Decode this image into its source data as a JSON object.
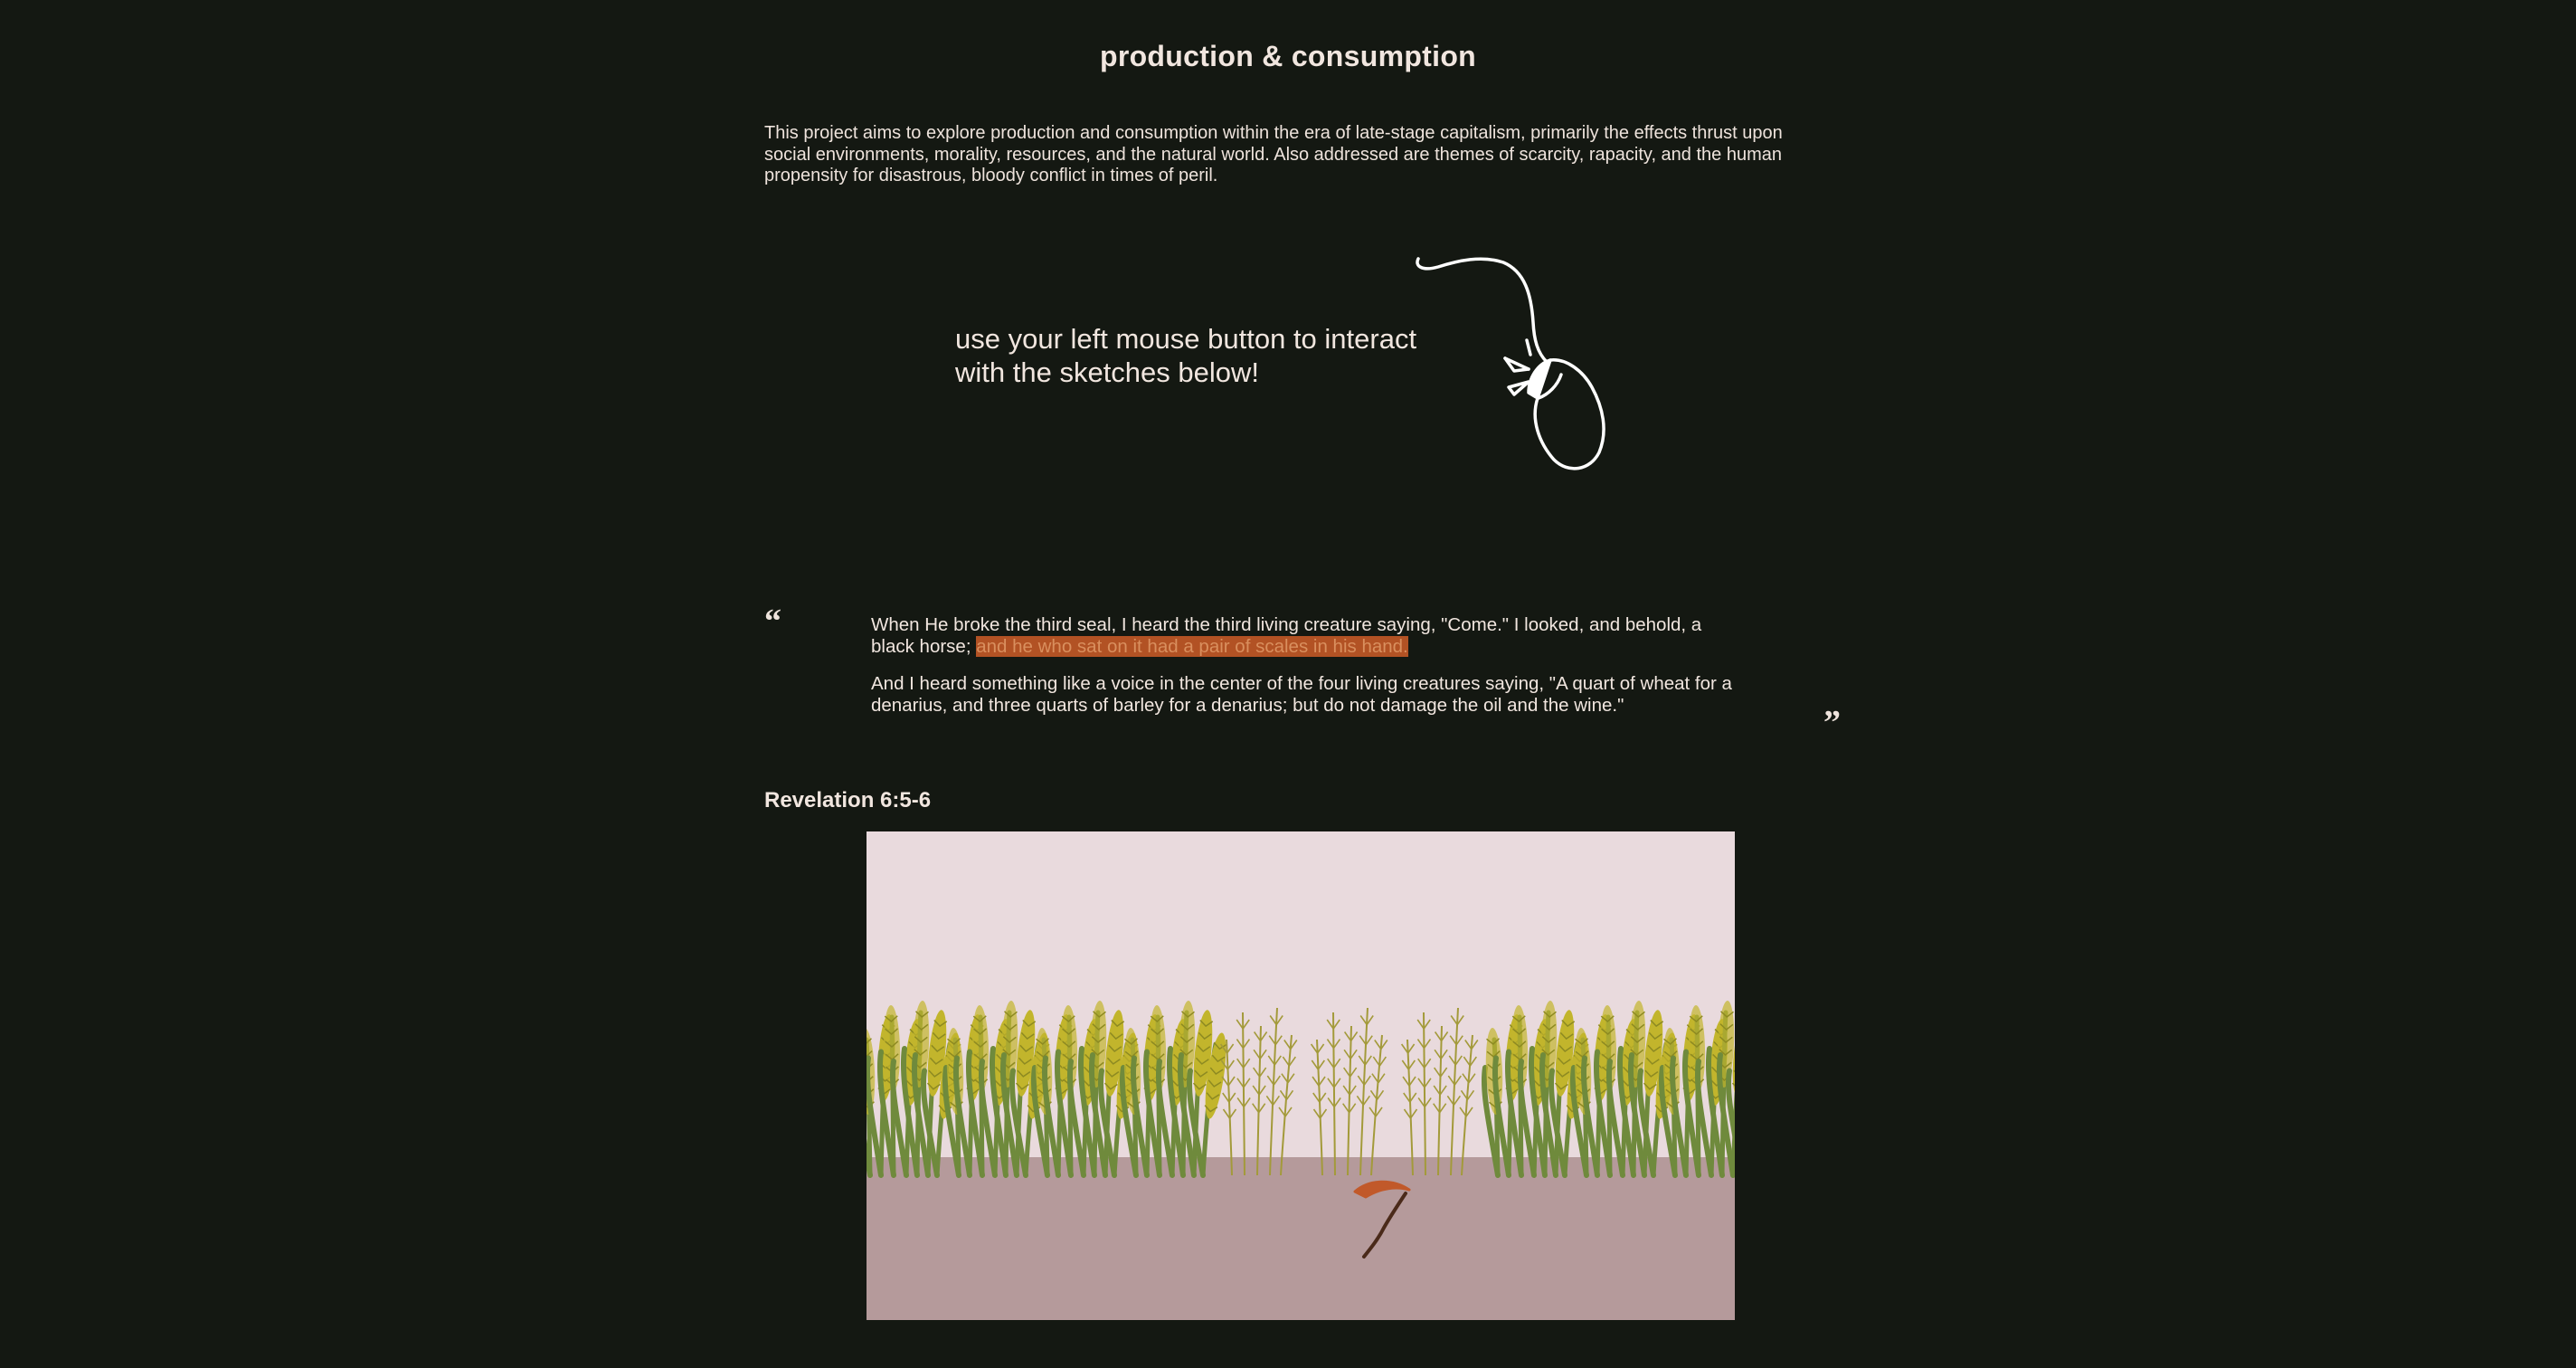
{
  "header": {
    "title": "production & consumption"
  },
  "intro": {
    "text": "This project aims to explore production and consumption within the era of late-stage capitalism, primarily the effects thrust upon social environments, morality, resources, and the natural world. Also addressed are themes of scarcity, rapacity, and the human propensity for disastrous, bloody conflict in times of peril."
  },
  "instruction": {
    "text": "use your left mouse button to interact with the sketches below!",
    "icon": "computer-mouse-icon"
  },
  "quote": {
    "open_mark": "“",
    "close_mark": "”",
    "verse1_plain": "When He broke the third seal, I heard the third living creature saying, \"Come.\" I looked, and behold, a black horse; ",
    "verse1_highlight": "and he who sat on it had a pair of scales in his hand.",
    "verse2": "And I heard something like a voice in the center of the four living creatures saying, \"A quart of wheat for a denarius, and three quarts of barley for a denarius; but do not damage the oil and the wine.\"",
    "citation": "Revelation 6:5-6"
  },
  "sketch": {
    "sky_color": "#e9dadd",
    "ground_color": "#b59a9b",
    "wheat_color": "#c2b52c",
    "stalk_color": "#6f8a3c",
    "dry_wheat_color": "#a39a3a",
    "scythe_blade_color": "#c1592a",
    "scythe_handle_color": "#4a2a1a",
    "icons": [
      "wheat-icon",
      "dry-wheat-icon",
      "scythe-icon"
    ]
  },
  "colors": {
    "background": "#141812",
    "text": "#eee3dc",
    "highlight": "#b25224"
  }
}
